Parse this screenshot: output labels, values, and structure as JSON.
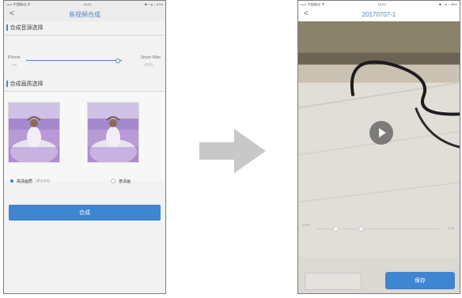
{
  "left_screen": {
    "status": {
      "carrier": "••••• 中国移动 令",
      "time": "15:21",
      "right": "✱ ↑ ● ↓ 97%"
    },
    "nav": {
      "back": "<",
      "title": "音视频合成"
    },
    "section1_title": "合成音源选择",
    "slider": {
      "left_label": "iPhone",
      "left_sub": "(m)",
      "right_label": "Smart Mike",
      "right_sub": "(外部)",
      "position": 0.96
    },
    "section2_title": "合成画质选择",
    "options": [
      {
        "label": "高清画质",
        "note": "(建议合成)",
        "selected": true
      },
      {
        "label": "普清画",
        "note": "",
        "selected": false
      }
    ],
    "primary_button": "合成"
  },
  "right_screen": {
    "status": {
      "carrier": "••••• 中国移动 令",
      "time": "15:22",
      "right": "✱ ↑ ● ↓ 95%"
    },
    "nav": {
      "back": "<",
      "title": "20170707-1"
    },
    "time_left": "0:00",
    "time_right": "0:34",
    "progress": [
      0.16,
      0.36
    ],
    "left_box": "",
    "save_button": "保存"
  },
  "colors": {
    "accent": "#3f85d0",
    "arrow": "#c8c8c8"
  }
}
